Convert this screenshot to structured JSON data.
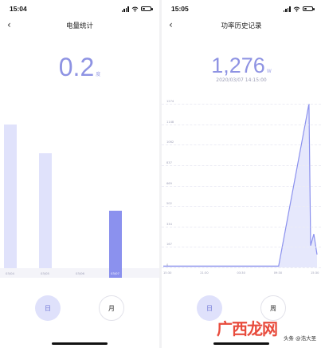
{
  "left": {
    "status": {
      "time": "15:04"
    },
    "nav": {
      "back_icon": "‹",
      "title": "电量统计"
    },
    "summary": {
      "value": "0.2",
      "unit": "度"
    },
    "chart_data": {
      "type": "bar",
      "categories": [
        "03/04",
        "03/05",
        "03/06",
        "03/07"
      ],
      "values": [
        1.0,
        0.8,
        0.0,
        0.4
      ],
      "selected": "03/07",
      "colors": {
        "bar": "#e0e2fb",
        "selected": "#8b91ee"
      }
    },
    "tabs": {
      "day": "日",
      "month": "月",
      "active": "day"
    }
  },
  "right": {
    "status": {
      "time": "15:05"
    },
    "nav": {
      "back_icon": "‹",
      "title": "功率历史记录"
    },
    "summary": {
      "value": "1,276",
      "unit": "W",
      "datetime": "2020/03/07 14:15:00"
    },
    "chart_data": {
      "type": "area",
      "y_ticks": [
        "1274",
        "1148",
        "1062",
        "837",
        "669",
        "502",
        "334",
        "167",
        "0"
      ],
      "x_ticks": [
        "15:30",
        "21:30",
        "03:30",
        "09:30",
        "15:30"
      ],
      "series": [
        {
          "x": [
            "15:30",
            "21:30",
            "03:30",
            "09:30",
            "14:15",
            "14:30",
            "15:00",
            "15:30"
          ],
          "y": [
            10,
            10,
            10,
            10,
            1276,
            170,
            260,
            100
          ]
        }
      ],
      "colors": {
        "line": "#8b91ee",
        "fill": "#e6e8fc"
      }
    },
    "tabs": {
      "day": "日",
      "week": "周",
      "active": "day"
    }
  },
  "watermark": {
    "main": "广西龙网",
    "sub": "头条 @浩大圣"
  }
}
